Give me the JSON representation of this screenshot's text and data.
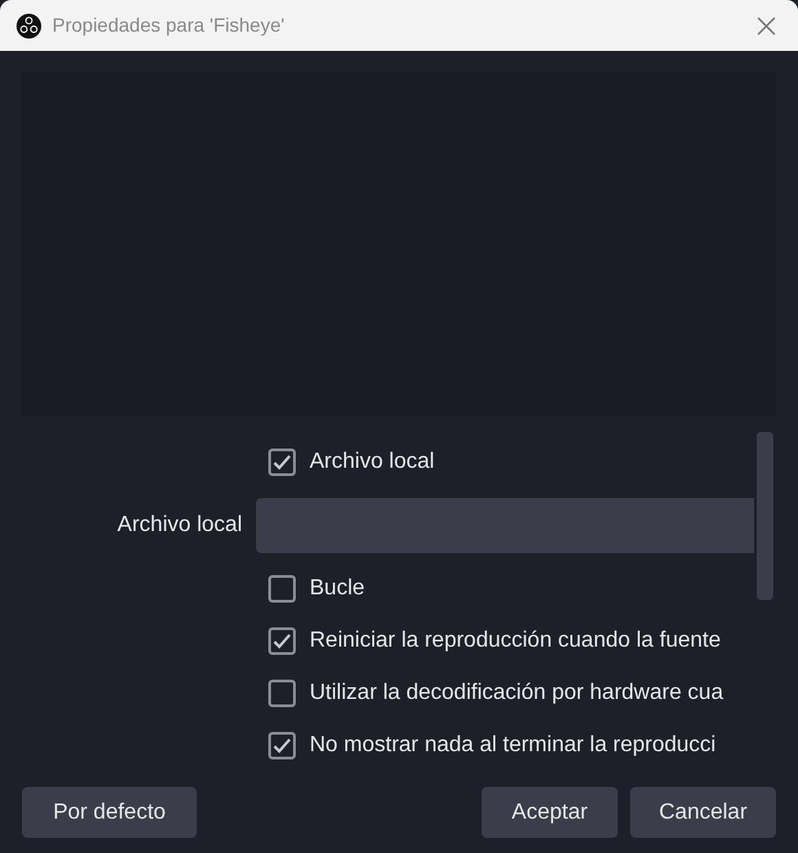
{
  "window": {
    "title": "Propiedades para 'Fisheye'"
  },
  "properties": [
    {
      "kind": "checkbox",
      "label": "Archivo local",
      "checked": true
    },
    {
      "kind": "file",
      "label": "Archivo local"
    },
    {
      "kind": "checkbox",
      "label": "Bucle",
      "checked": false
    },
    {
      "kind": "checkbox",
      "label": "Reiniciar la reproducción cuando la fuente",
      "checked": true
    },
    {
      "kind": "checkbox",
      "label": "Utilizar la decodificación por hardware cua",
      "checked": false
    },
    {
      "kind": "checkbox",
      "label": "No mostrar nada al terminar la reproducci",
      "checked": true
    }
  ],
  "buttons": {
    "defaults": "Por defecto",
    "ok": "Aceptar",
    "cancel": "Cancelar"
  }
}
